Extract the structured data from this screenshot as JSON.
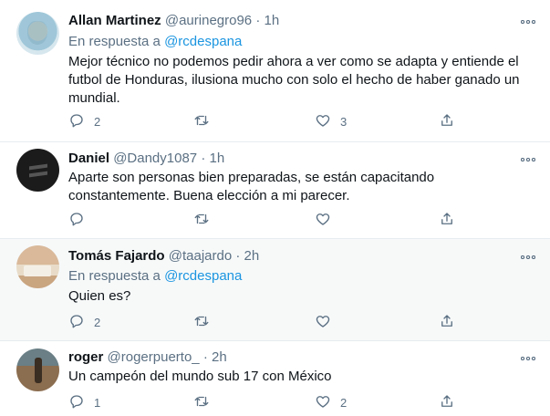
{
  "tweets": [
    {
      "name": "Allan Martinez",
      "handle": "@aurinegro96",
      "time": "1h",
      "reply_prefix": "En respuesta a",
      "reply_to": "@rcdespana",
      "text": "Mejor técnico no podemos pedir ahora a ver como se adapta y entiende el futbol de Honduras, ilusiona mucho con solo el hecho de haber ganado un mundial.",
      "replies": "2",
      "retweets": "",
      "likes": "3"
    },
    {
      "name": "Daniel",
      "handle": "@Dandy1087",
      "time": "1h",
      "text": "Aparte son personas bien preparadas, se están capacitando constantemente. Buena elección a mi parecer.",
      "replies": "",
      "retweets": "",
      "likes": ""
    },
    {
      "name": "Tomás Fajardo",
      "handle": "@taajardo",
      "time": "2h",
      "reply_prefix": "En respuesta a",
      "reply_to": "@rcdespana",
      "text": "Quien es?",
      "replies": "2",
      "retweets": "",
      "likes": ""
    },
    {
      "name": "roger",
      "handle": "@rogerpuerto_",
      "time": "2h",
      "text": "Un campeón del mundo sub 17 con México",
      "replies": "1",
      "retweets": "",
      "likes": "2"
    }
  ],
  "dot": "·",
  "icons": [
    "reply-icon",
    "retweet-icon",
    "like-icon",
    "share-icon",
    "more-icon"
  ],
  "colors": {
    "link": "#1b95e0",
    "secondary": "#5b7083",
    "hover_bg": "#f7f9f9"
  }
}
